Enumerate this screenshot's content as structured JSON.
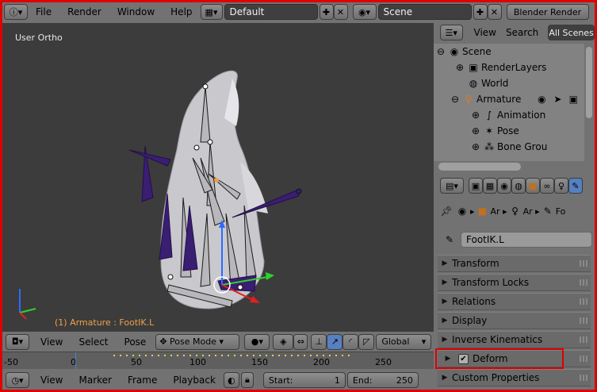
{
  "header": {
    "menus": [
      "File",
      "Render",
      "Window",
      "Help"
    ],
    "layout": "Default",
    "scene": "Scene",
    "engine": "Blender Render"
  },
  "viewport": {
    "view_label": "User Ortho",
    "status": "(1) Armature : FootIK.L",
    "status_color": "#f0a04a",
    "background": "#3c3c3c"
  },
  "view3d_header": {
    "menus": [
      "View",
      "Select",
      "Pose"
    ],
    "mode": "Pose Mode",
    "orientation": "Global"
  },
  "timeline": {
    "ticks": [
      "-50",
      "0",
      "50",
      "100",
      "150",
      "200",
      "250"
    ],
    "menus": [
      "View",
      "Marker",
      "Frame",
      "Playback"
    ],
    "start_label": "Start:",
    "start_value": "1",
    "end_label": "End:",
    "end_value": "250"
  },
  "outliner": {
    "menus": [
      "View",
      "Search"
    ],
    "filter": "All Scenes",
    "rows": [
      {
        "label": "Scene",
        "depth": 0,
        "toggle": "⊖"
      },
      {
        "label": "RenderLayers",
        "depth": 1,
        "toggle": "⊕"
      },
      {
        "label": "World",
        "depth": 1,
        "toggle": ""
      },
      {
        "label": "Armature",
        "depth": 1,
        "toggle": "⊖"
      },
      {
        "label": "Animation",
        "depth": 2,
        "toggle": "⊕"
      },
      {
        "label": "Pose",
        "depth": 2,
        "toggle": "⊕"
      },
      {
        "label": "Bone Grou",
        "depth": 2,
        "toggle": "⊕"
      }
    ]
  },
  "properties": {
    "breadcrumb": [
      "Ar",
      "Ar",
      "Fo"
    ],
    "bone_name": "FootIK.L",
    "panels": [
      "Transform",
      "Transform Locks",
      "Relations",
      "Display",
      "Inverse Kinematics",
      "Deform",
      "Custom Properties"
    ],
    "highlight_panel": "Deform",
    "highlight_color": "#e00000"
  }
}
